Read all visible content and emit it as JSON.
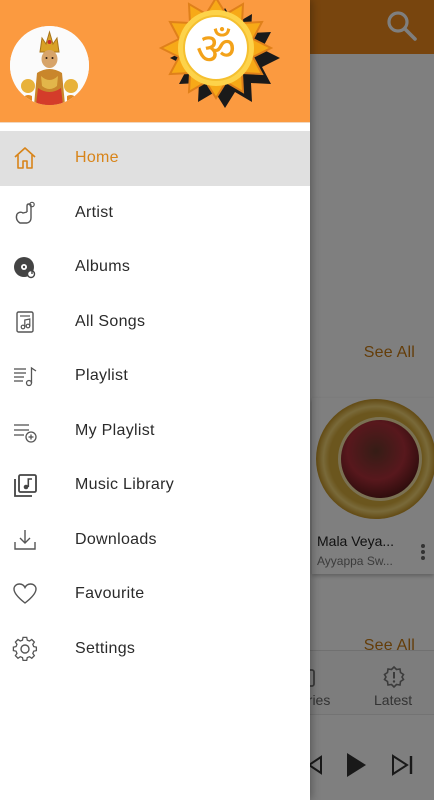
{
  "background": {
    "see_all_1": "See All",
    "see_all_2": "See All",
    "card": {
      "title": "Mala Veya...",
      "subtitle": "Ayyappa Sw..."
    },
    "tabs": [
      "ories",
      "Latest"
    ]
  },
  "drawer": {
    "menu": [
      {
        "label": "Home",
        "icon": "home-icon",
        "active": true
      },
      {
        "label": "Artist",
        "icon": "artist-hand-icon"
      },
      {
        "label": "Albums",
        "icon": "album-disc-icon"
      },
      {
        "label": "All Songs",
        "icon": "song-file-icon"
      },
      {
        "label": "Playlist",
        "icon": "playlist-icon"
      },
      {
        "label": "My Playlist",
        "icon": "playlist-add-icon"
      },
      {
        "label": "Music Library",
        "icon": "music-library-icon"
      },
      {
        "label": "Downloads",
        "icon": "download-icon"
      },
      {
        "label": "Favourite",
        "icon": "heart-icon"
      },
      {
        "label": "Settings",
        "icon": "gear-icon"
      }
    ]
  },
  "colors": {
    "header": "#fb9a40",
    "active_text": "#d88419",
    "active_bg": "#e0e0e0",
    "topbar": "#f08a1c"
  }
}
